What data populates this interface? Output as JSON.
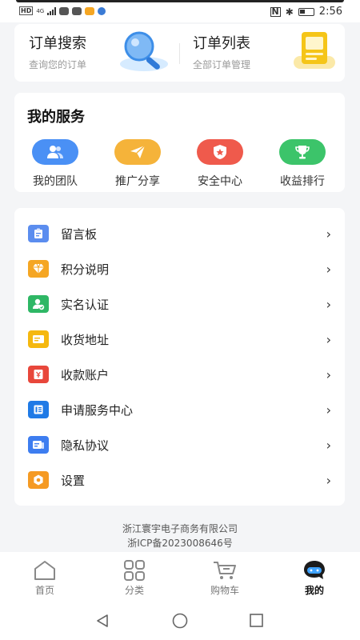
{
  "status_bar": {
    "left_badge": "HD",
    "network": "4G",
    "time": "2:56"
  },
  "orders": {
    "search": {
      "title": "订单搜索",
      "subtitle": "查询您的订单",
      "icon": "magnifier-icon"
    },
    "list": {
      "title": "订单列表",
      "subtitle": "全部订单管理",
      "icon": "document-icon"
    }
  },
  "services": {
    "title": "我的服务",
    "items": [
      {
        "label": "我的团队",
        "icon": "team-icon",
        "color": "#4a90f5"
      },
      {
        "label": "推广分享",
        "icon": "paper-plane-icon",
        "color": "#f5b33a"
      },
      {
        "label": "安全中心",
        "icon": "shield-icon",
        "color": "#ef5a4c"
      },
      {
        "label": "收益排行",
        "icon": "trophy-icon",
        "color": "#3cc46a"
      }
    ]
  },
  "menu": {
    "items": [
      {
        "label": "留言板",
        "icon": "clipboard-icon",
        "color": "#5b8def"
      },
      {
        "label": "积分说明",
        "icon": "diamond-icon",
        "color": "#f5a623"
      },
      {
        "label": "实名认证",
        "icon": "id-verify-icon",
        "color": "#2eb765"
      },
      {
        "label": "收货地址",
        "icon": "address-icon",
        "color": "#f5b80f"
      },
      {
        "label": "收款账户",
        "icon": "account-icon",
        "color": "#e8473b"
      },
      {
        "label": "申请服务中心",
        "icon": "service-center-icon",
        "color": "#1f7ae6"
      },
      {
        "label": "隐私协议",
        "icon": "privacy-doc-icon",
        "color": "#3d7df0"
      },
      {
        "label": "设置",
        "icon": "settings-icon",
        "color": "#f59a23"
      }
    ]
  },
  "footer": {
    "company": "浙江寰宇电子商务有限公司",
    "icp": "浙ICP备2023008646号"
  },
  "tabs": [
    {
      "label": "首页",
      "icon": "home-icon"
    },
    {
      "label": "分类",
      "icon": "grid-icon"
    },
    {
      "label": "购物车",
      "icon": "cart-icon"
    },
    {
      "label": "我的",
      "icon": "profile-chat-icon",
      "active": true
    }
  ],
  "system_nav": [
    "back-icon",
    "home-circle-icon",
    "recents-icon"
  ]
}
